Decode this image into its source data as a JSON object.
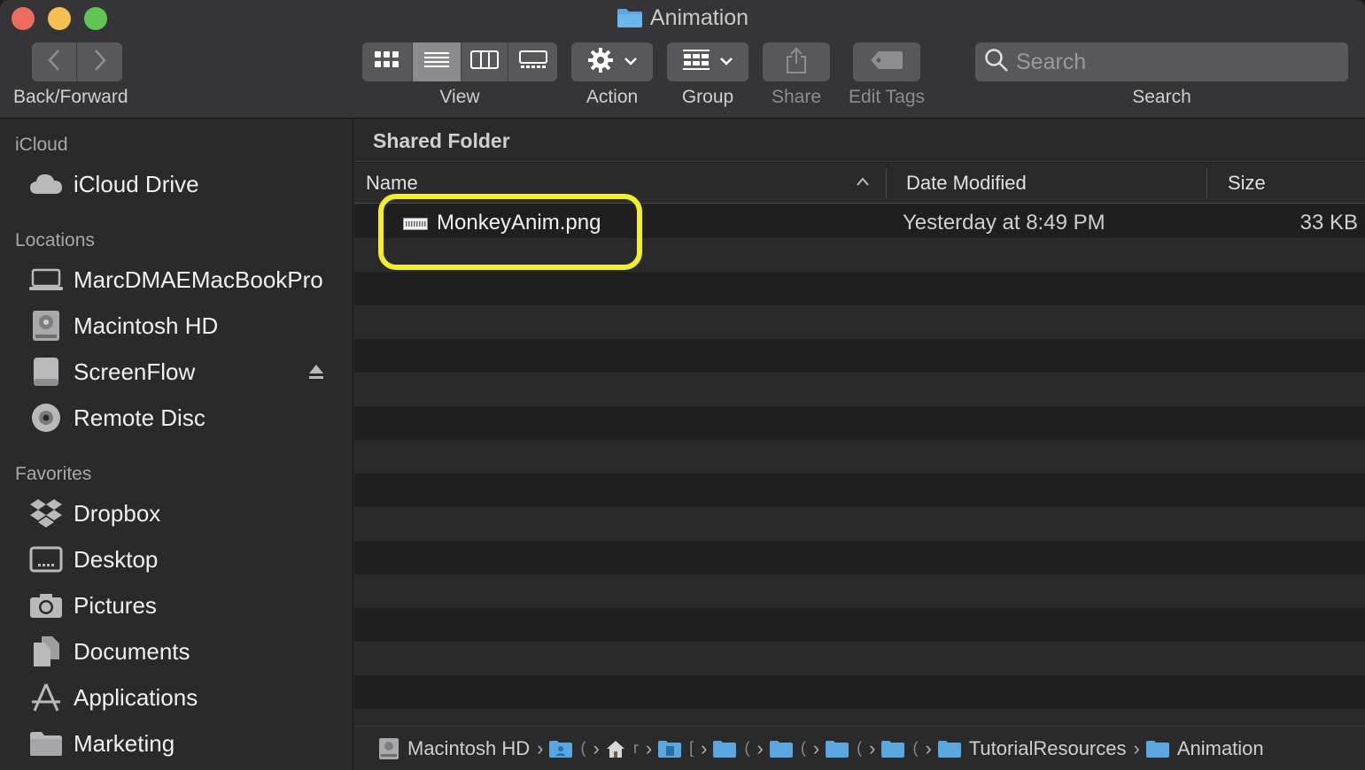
{
  "window": {
    "title": "Animation"
  },
  "toolbar": {
    "back_forward_label": "Back/Forward",
    "view_label": "View",
    "action_label": "Action",
    "group_label": "Group",
    "share_label": "Share",
    "edit_tags_label": "Edit Tags",
    "search_label": "Search",
    "search_placeholder": "Search",
    "active_view": "list"
  },
  "sidebar": {
    "sections": [
      {
        "heading": "iCloud",
        "items": [
          {
            "label": "iCloud Drive",
            "icon": "cloud-icon"
          }
        ]
      },
      {
        "heading": "Locations",
        "items": [
          {
            "label": "MarcDMAEMacBookPro",
            "icon": "laptop-icon"
          },
          {
            "label": "Macintosh HD",
            "icon": "hard-drive-icon"
          },
          {
            "label": "ScreenFlow",
            "icon": "external-drive-icon",
            "ejectable": true
          },
          {
            "label": "Remote Disc",
            "icon": "disc-icon"
          }
        ]
      },
      {
        "heading": "Favorites",
        "items": [
          {
            "label": "Dropbox",
            "icon": "dropbox-icon"
          },
          {
            "label": "Desktop",
            "icon": "desktop-icon"
          },
          {
            "label": "Pictures",
            "icon": "camera-icon"
          },
          {
            "label": "Documents",
            "icon": "documents-icon"
          },
          {
            "label": "Applications",
            "icon": "applications-icon"
          },
          {
            "label": "Marketing",
            "icon": "folder-icon"
          }
        ]
      }
    ]
  },
  "main": {
    "group_title": "Shared Folder",
    "columns": {
      "name": "Name",
      "date": "Date Modified",
      "size": "Size"
    },
    "files": [
      {
        "name": "MonkeyAnim.png",
        "date": "Yesterday at 8:49 PM",
        "size": "33 KB",
        "icon": "image-file-icon"
      }
    ]
  },
  "pathbar": {
    "crumbs": [
      {
        "label": "Macintosh HD",
        "icon": "hard-drive-icon"
      },
      {
        "label": "",
        "icon": "user-folder-icon"
      },
      {
        "label": "",
        "icon": "home-icon"
      },
      {
        "label": "",
        "icon": "documents-folder-icon"
      },
      {
        "label": "",
        "icon": "folder-icon"
      },
      {
        "label": "",
        "icon": "folder-icon"
      },
      {
        "label": "",
        "icon": "folder-icon"
      },
      {
        "label": "",
        "icon": "folder-icon"
      },
      {
        "label": "TutorialResources",
        "icon": "folder-icon"
      },
      {
        "label": "Animation",
        "icon": "folder-icon"
      }
    ]
  },
  "colors": {
    "highlight": "#f5ec2a",
    "folder_blue": "#5aa7e0",
    "window_bg": "#2b2b2c"
  }
}
